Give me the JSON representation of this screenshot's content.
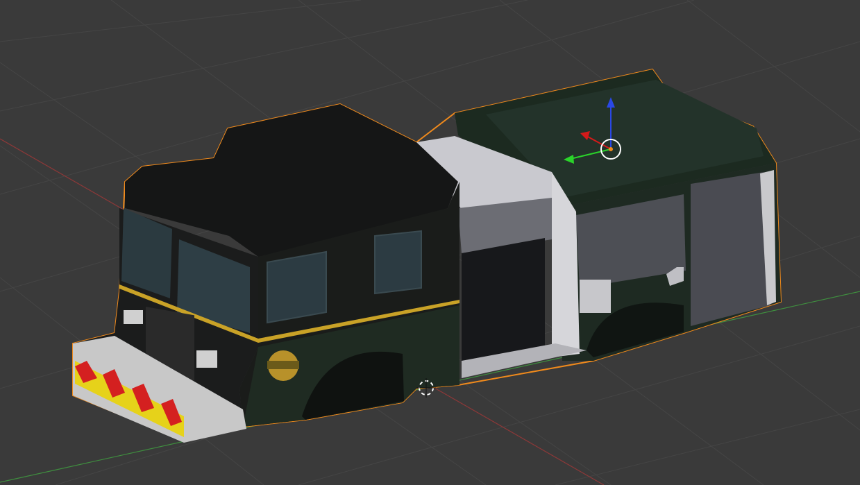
{
  "viewport": {
    "view_mode": "3D Viewport",
    "background_color": "#3a3a3a",
    "grid_color": "#464646",
    "x_axis_color": "#9b3a3a",
    "y_axis_color": "#3f8f3f",
    "selection_outline_color": "#f08a1c"
  },
  "object": {
    "type": "mesh",
    "name_icon": "fire-truck-model",
    "selected": true,
    "body_color": "#1f2b22",
    "cab_roof_color": "#141414",
    "stripe_color": "#c9a227",
    "bumper_color": "#c8c8c8",
    "chevron_colors": [
      "#d42020",
      "#e6d21a"
    ],
    "window_color": "#2b3a40",
    "panel_color": "#d0d0d4",
    "badge_icon": "maltese-cross-badge-icon"
  },
  "gizmo": {
    "z_color": "#2a48e6",
    "x_color": "#d41a1a",
    "y_color": "#2ad42a"
  }
}
